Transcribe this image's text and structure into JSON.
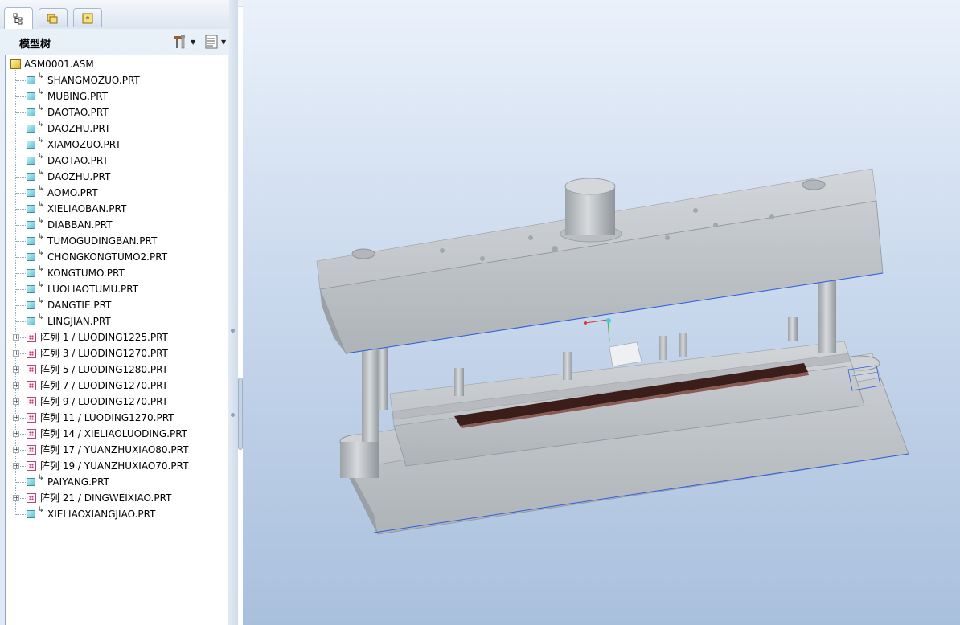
{
  "panel": {
    "title": "模型树",
    "tabs": [
      {
        "icon": "model-tree-icon",
        "active": true
      },
      {
        "icon": "folder-browser-icon",
        "active": false
      },
      {
        "icon": "favorites-icon",
        "active": false
      }
    ],
    "tools": [
      {
        "icon": "tree-settings-icon"
      },
      {
        "icon": "show-options-icon"
      }
    ]
  },
  "tree": {
    "root": "ASM0001.ASM",
    "items": [
      {
        "label": "SHANGMOZUO.PRT",
        "kind": "part"
      },
      {
        "label": "MUBING.PRT",
        "kind": "part"
      },
      {
        "label": "DAOTAO.PRT",
        "kind": "part"
      },
      {
        "label": "DAOZHU.PRT",
        "kind": "part"
      },
      {
        "label": "XIAMOZUO.PRT",
        "kind": "part"
      },
      {
        "label": "DAOTAO.PRT",
        "kind": "part"
      },
      {
        "label": "DAOZHU.PRT",
        "kind": "part"
      },
      {
        "label": "AOMO.PRT",
        "kind": "part"
      },
      {
        "label": "XIELIAOBAN.PRT",
        "kind": "part"
      },
      {
        "label": "DIABBAN.PRT",
        "kind": "part"
      },
      {
        "label": "TUMOGUDINGBAN.PRT",
        "kind": "part"
      },
      {
        "label": "CHONGKONGTUMO2.PRT",
        "kind": "part"
      },
      {
        "label": "KONGTUMO.PRT",
        "kind": "part"
      },
      {
        "label": "LUOLIAOTUMU.PRT",
        "kind": "part"
      },
      {
        "label": "DANGTIE.PRT",
        "kind": "part"
      },
      {
        "label": "LINGJIAN.PRT",
        "kind": "part"
      },
      {
        "label": "阵列 1 / LUODING1225.PRT",
        "kind": "pattern"
      },
      {
        "label": "阵列 3 / LUODING1270.PRT",
        "kind": "pattern"
      },
      {
        "label": "阵列 5 / LUODING1280.PRT",
        "kind": "pattern"
      },
      {
        "label": "阵列 7 / LUODING1270.PRT",
        "kind": "pattern"
      },
      {
        "label": "阵列 9 / LUODING1270.PRT",
        "kind": "pattern"
      },
      {
        "label": "阵列 11 / LUODING1270.PRT",
        "kind": "pattern"
      },
      {
        "label": "阵列 14 / XIELIAOLUODING.PRT",
        "kind": "pattern"
      },
      {
        "label": "阵列 17 / YUANZHUXIAO80.PRT",
        "kind": "pattern"
      },
      {
        "label": "阵列 19 / YUANZHUXIAO70.PRT",
        "kind": "pattern"
      },
      {
        "label": "PAIYANG.PRT",
        "kind": "part"
      },
      {
        "label": "阵列 21 / DINGWEIXIAO.PRT",
        "kind": "pattern"
      },
      {
        "label": "XIELIAOXIANGJIAO.PRT",
        "kind": "part"
      }
    ]
  },
  "colors": {
    "background_top": "#eaf1fb",
    "background_bottom": "#a9c0dd",
    "model_body": "#c7cacd",
    "strip": "#3b1e1a",
    "edge_highlight": "#2f5fe0"
  }
}
